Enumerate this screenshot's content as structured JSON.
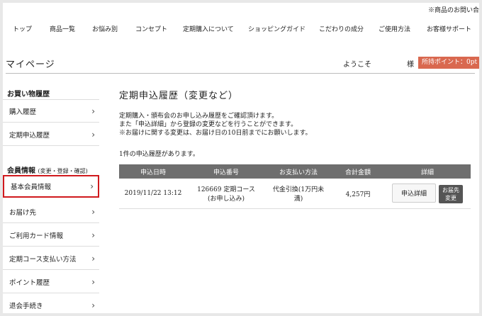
{
  "header": {
    "notice": "※商品のお問い合"
  },
  "nav": [
    "トップ",
    "商品一覧",
    "お悩み別",
    "コンセプト",
    "定期購入について",
    "ショッピングガイド",
    "こだわりの成分",
    "ご使用方法",
    "お客様サポート"
  ],
  "account": {
    "page_title": "マイページ",
    "welcome": "ようこそ",
    "honorific": "様",
    "points": "所持ポイント：0pt"
  },
  "sidebar": {
    "purchase_head": "お買い物履歴",
    "purchase_items": [
      "購入履歴",
      "定期申込履歴"
    ],
    "member_head": "会員情報",
    "member_note": "(変更・登録・確認)",
    "member_items": [
      "基本会員情報",
      "お届け先",
      "ご利用カード情報",
      "定期コース支払い方法",
      "ポイント履歴",
      "退会手続き"
    ]
  },
  "main": {
    "title": "定期申込履歴（変更など）",
    "desc": [
      "定期購入・頒布会のお申し込み履歴をご確認頂けます。",
      "また「申込詳細」から登録の変更などを行うことができます。",
      "※お届けに関する変更は、お届け日の10日前までにお願いします。"
    ],
    "count_text": "1件の申込履歴があります。",
    "table": {
      "headers": [
        "申込日時",
        "申込番号",
        "お支払い方法",
        "合計金額",
        "詳細"
      ],
      "row": {
        "date": "2019/11/22 13:12",
        "number_line1": "126669 定期コース",
        "number_line2": "(お申し込み)",
        "payment_line1": "代金引換(1万円未",
        "payment_line2": "満)",
        "total": "4,257円",
        "detail_button": "申込詳細",
        "change_line1": "お届先",
        "change_line2": "変更"
      }
    }
  },
  "colors": {
    "accent": "#d9684f",
    "active_border": "#d0191d",
    "table_header": "#6e6e6e"
  }
}
